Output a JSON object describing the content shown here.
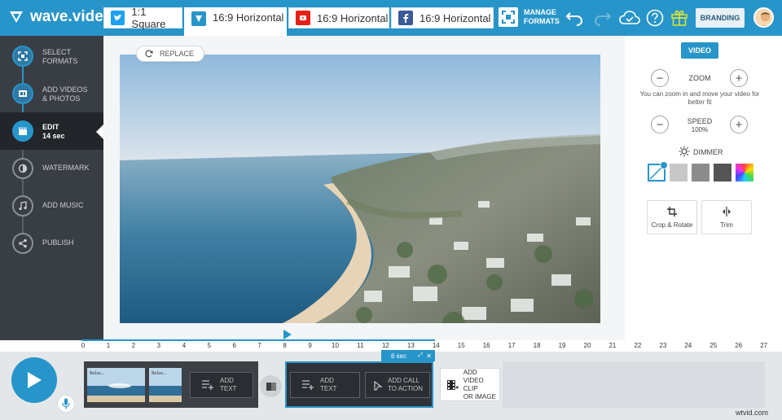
{
  "app": {
    "logo_text": "wave.video",
    "manage_formats": [
      "MANAGE",
      "FORMATS"
    ],
    "branding_label": "BRANDING",
    "format_tabs": [
      {
        "label": "1:1 Square",
        "network": "twitter",
        "color": "#1da1f2",
        "active": false
      },
      {
        "label": "16:9 Horizontal",
        "network": "wave",
        "color": "#2795c9",
        "active": true
      },
      {
        "label": "16:9 Horizontal",
        "network": "youtube",
        "color": "#e62117",
        "active": false
      },
      {
        "label": "16:9 Horizontal",
        "network": "facebook",
        "color": "#3b5998",
        "active": false
      }
    ],
    "accent_color": "#2795c9"
  },
  "sidebar": {
    "steps": [
      {
        "label_l1": "SELECT",
        "label_l2": "FORMATS",
        "icon": "formats-icon",
        "state": "done"
      },
      {
        "label_l1": "ADD VIDEOS",
        "label_l2": "& PHOTOS",
        "icon": "media-icon",
        "state": "done"
      },
      {
        "label_l1": "EDIT",
        "label_l2": "14 sec",
        "icon": "clapper-icon",
        "state": "active"
      },
      {
        "label_l1": "WATERMARK",
        "label_l2": "",
        "icon": "watermark-icon",
        "state": "pending"
      },
      {
        "label_l1": "ADD MUSIC",
        "label_l2": "",
        "icon": "music-icon",
        "state": "pending"
      },
      {
        "label_l1": "PUBLISH",
        "label_l2": "",
        "icon": "share-icon",
        "state": "pending"
      }
    ]
  },
  "stage": {
    "replace_label": "REPLACE"
  },
  "panel": {
    "video_tab": "VIDEO",
    "zoom_label": "ZOOM",
    "zoom_hint": "You can zoom in and move your video for better fit",
    "speed_label": "SPEED",
    "speed_value": "100%",
    "dimmer_label": "DIMMER",
    "dimmer_swatches": [
      "none",
      "#c8c8c8",
      "#8c8c8c",
      "#555555",
      "rainbow"
    ],
    "crop_label": "Crop & Rotate",
    "trim_label": "Trim"
  },
  "timeline": {
    "ticks": [
      "0",
      "1",
      "2",
      "3",
      "4",
      "5",
      "6",
      "7",
      "8",
      "9",
      "10",
      "11",
      "12",
      "13",
      "14",
      "15",
      "16",
      "17",
      "18",
      "19",
      "20",
      "21",
      "22",
      "23",
      "24",
      "25",
      "26",
      "27"
    ],
    "clip1": {
      "thumb_caption": "Relax...",
      "add_text": [
        "ADD",
        "TEXT"
      ]
    },
    "clip2": {
      "duration": "6 sec",
      "add_text": [
        "ADD",
        "TEXT"
      ],
      "add_cta": [
        "ADD CALL",
        "TO ACTION"
      ]
    },
    "add_clip": [
      "ADD",
      "VIDEO CLIP",
      "OR IMAGE"
    ],
    "watermark": "wtvid.com"
  }
}
